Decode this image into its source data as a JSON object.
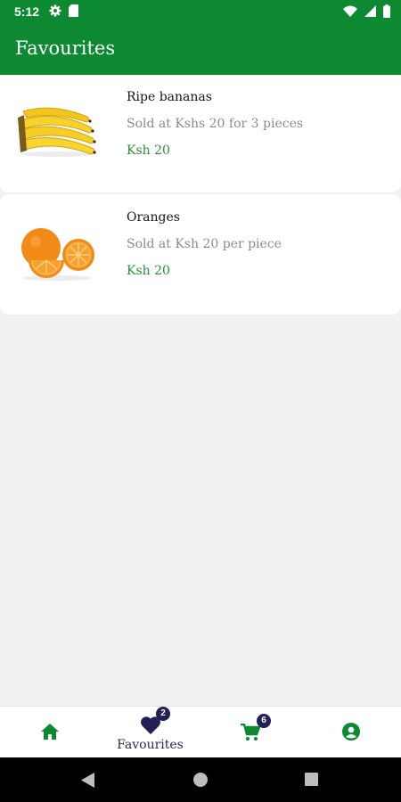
{
  "status_bar": {
    "time": "5:12",
    "left_icons": [
      "settings-icon",
      "sim-card-icon"
    ],
    "right_icons": [
      "wifi-icon",
      "cell-signal-icon",
      "battery-icon"
    ]
  },
  "app_bar": {
    "title": "Favourites"
  },
  "favourites": [
    {
      "name": "Ripe bananas",
      "description": "Sold at Kshs 20 for 3 pieces",
      "price": "Ksh 20",
      "image": "banana-image"
    },
    {
      "name": "Oranges",
      "description": "Sold at Ksh 20 per piece",
      "price": "Ksh 20",
      "image": "orange-image"
    }
  ],
  "bottom_nav": {
    "items": [
      {
        "id": "home",
        "icon": "home-icon",
        "label": ""
      },
      {
        "id": "favourites",
        "icon": "heart-icon",
        "label": "Favourites",
        "badge": "2",
        "selected": true
      },
      {
        "id": "cart",
        "icon": "cart-icon",
        "label": "",
        "badge": "6"
      },
      {
        "id": "account",
        "icon": "account-icon",
        "label": ""
      }
    ]
  },
  "system_nav": {
    "buttons": [
      "back-icon",
      "home-circle-icon",
      "recents-icon"
    ]
  },
  "colors": {
    "primary": "#0d8a31",
    "price": "#2e8b3e",
    "nav_active": "#232055",
    "background": "#f2f1f2"
  }
}
